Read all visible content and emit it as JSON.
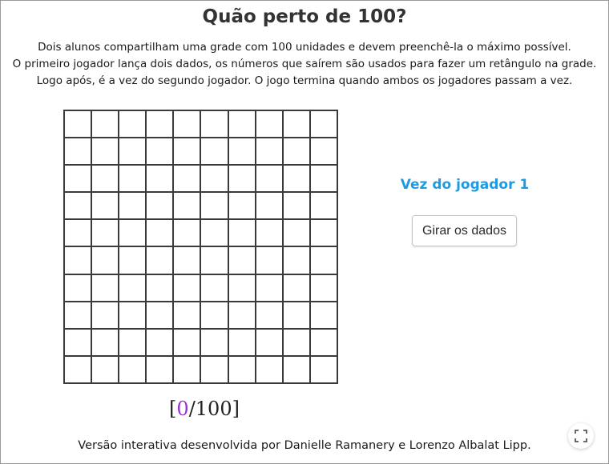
{
  "title": "Quão perto de 100?",
  "description": [
    "Dois alunos compartilham uma grade com 100 unidades e devem preenchê-la o máximo possível.",
    "O primeiro jogador lança dois dados, os números que saírem são usados para fazer um retângulo na grade.",
    "Logo após, é a vez do segundo jogador. O jogo termina quando ambos os jogadores passam a vez."
  ],
  "grid": {
    "rows": 10,
    "cols": 10,
    "filled_cells": 0
  },
  "score": {
    "open": "[",
    "current": "0",
    "separator": "/",
    "total": "100",
    "close": "]"
  },
  "turn_label": "Vez do jogador 1",
  "roll_button_label": "Girar os dados",
  "footer": "Versão interativa desenvolvida por Danielle Ramanery e Lorenzo Albalat Lipp.",
  "colors": {
    "title": "#333333",
    "turn": "#1e9be0",
    "score_current": "#9b30d9",
    "grid_line": "#3a3a3a"
  },
  "icons": {
    "fullscreen": "fullscreen-icon"
  }
}
